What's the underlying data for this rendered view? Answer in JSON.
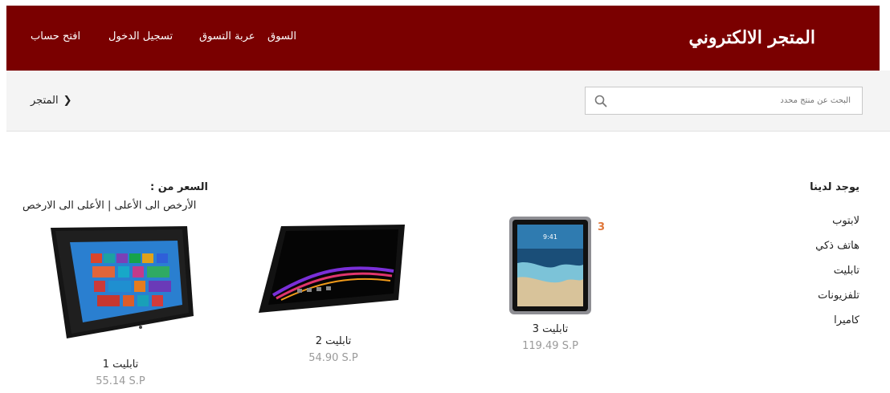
{
  "header": {
    "brand": "المتجر الالكتروني",
    "nav": {
      "market": "السوق",
      "cart": "عربة التسوق",
      "login": "تسجيل الدخول",
      "signup": "افتح حساب"
    }
  },
  "subbar": {
    "breadcrumb": "المتجر",
    "search_placeholder": "البحث عن منتج محدد"
  },
  "categories": {
    "title": "يوجد لدينا",
    "items": [
      "لابتوب",
      "هاتف ذكي",
      "تابليت",
      "تلفزيونات",
      "كاميرا"
    ]
  },
  "sort": {
    "label": "السعر من :",
    "low_to_high": "الأرخص الى الأعلى",
    "separator": "|",
    "high_to_low": "الأعلى الى الارخص"
  },
  "products": [
    {
      "name": "تابليت 1",
      "price": "55.14 S.P"
    },
    {
      "name": "تابليت 2",
      "price": "54.90 S.P"
    },
    {
      "name": "تابليت 3",
      "price": "119.49 S.P",
      "badge": "3"
    }
  ],
  "colors": {
    "brand_bar": "#7a0000",
    "price": "#9a9a9a",
    "badge": "#e0773a"
  }
}
